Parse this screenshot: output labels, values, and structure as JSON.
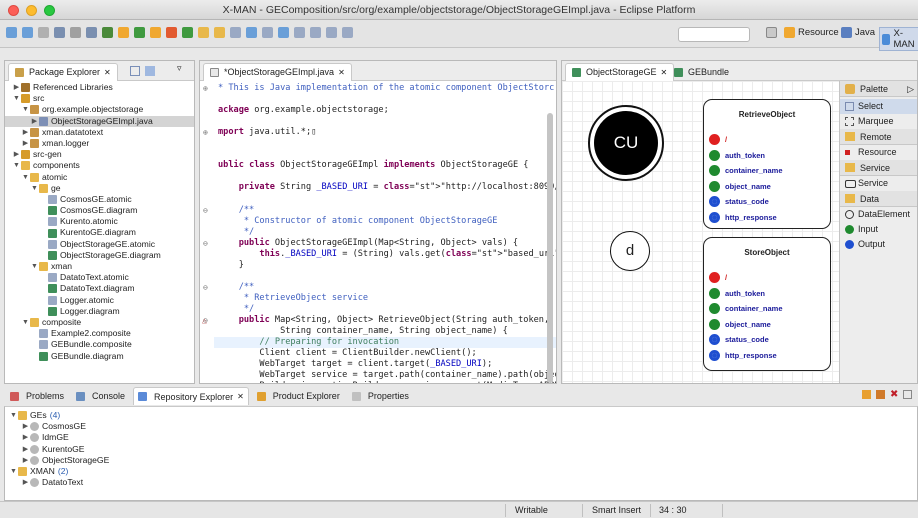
{
  "window": {
    "title": "X-MAN - GEComposition/src/org/example/objectstorage/ObjectStorageGEImpl.java - Eclipse Platform"
  },
  "toolbar": {
    "perspectives": [
      "Resource",
      "Java",
      "X-MAN"
    ]
  },
  "package_explorer": {
    "tab": "Package Explorer",
    "items": [
      {
        "label": "Referenced Libraries",
        "depth": 1,
        "twisty": "▶",
        "icon": "#a0702a"
      },
      {
        "label": "src",
        "depth": 1,
        "twisty": "▼",
        "icon": "#d69b2a"
      },
      {
        "label": "org.example.objectstorage",
        "depth": 2,
        "twisty": "▼",
        "icon": "#c79445"
      },
      {
        "label": "ObjectStorageGEImpl.java",
        "depth": 3,
        "twisty": "▶",
        "icon": "#7d8fb5",
        "selected": true
      },
      {
        "label": "xman.datatotext",
        "depth": 2,
        "twisty": "▶",
        "icon": "#c79445"
      },
      {
        "label": "xman.logger",
        "depth": 2,
        "twisty": "▶",
        "icon": "#c79445"
      },
      {
        "label": "src-gen",
        "depth": 1,
        "twisty": "▶",
        "icon": "#d69b2a"
      },
      {
        "label": "components",
        "depth": 1,
        "twisty": "▼",
        "icon": "#e8b84a"
      },
      {
        "label": "atomic",
        "depth": 2,
        "twisty": "▼",
        "icon": "#e8b84a"
      },
      {
        "label": "ge",
        "depth": 3,
        "twisty": "▼",
        "icon": "#e8b84a"
      },
      {
        "label": "CosmosGE.atomic",
        "depth": 4,
        "twisty": "",
        "icon": "#9aa9c4"
      },
      {
        "label": "CosmosGE.diagram",
        "depth": 4,
        "twisty": "",
        "icon": "#3f8f5a"
      },
      {
        "label": "Kurento.atomic",
        "depth": 4,
        "twisty": "",
        "icon": "#9aa9c4"
      },
      {
        "label": "KurentoGE.diagram",
        "depth": 4,
        "twisty": "",
        "icon": "#3f8f5a"
      },
      {
        "label": "ObjectStorageGE.atomic",
        "depth": 4,
        "twisty": "",
        "icon": "#9aa9c4"
      },
      {
        "label": "ObjectStorageGE.diagram",
        "depth": 4,
        "twisty": "",
        "icon": "#3f8f5a"
      },
      {
        "label": "xman",
        "depth": 3,
        "twisty": "▼",
        "icon": "#e8b84a"
      },
      {
        "label": "DatatoText.atomic",
        "depth": 4,
        "twisty": "",
        "icon": "#9aa9c4"
      },
      {
        "label": "DatatoText.diagram",
        "depth": 4,
        "twisty": "",
        "icon": "#3f8f5a"
      },
      {
        "label": "Logger.atomic",
        "depth": 4,
        "twisty": "",
        "icon": "#9aa9c4"
      },
      {
        "label": "Logger.diagram",
        "depth": 4,
        "twisty": "",
        "icon": "#3f8f5a"
      },
      {
        "label": "composite",
        "depth": 2,
        "twisty": "▼",
        "icon": "#e8b84a"
      },
      {
        "label": "Example2.composite",
        "depth": 3,
        "twisty": "",
        "icon": "#9aa9c4"
      },
      {
        "label": "GEBundle.composite",
        "depth": 3,
        "twisty": "",
        "icon": "#9aa9c4"
      },
      {
        "label": "GEBundle.diagram",
        "depth": 3,
        "twisty": "",
        "icon": "#3f8f5a"
      }
    ]
  },
  "editor": {
    "tab": "*ObjectStorageGEImpl.java",
    "lines": [
      {
        "t": "* This is Java implementation of the atomic component ObjectStorc",
        "c": "cm",
        "fold": "⊕"
      },
      {
        "t": "",
        "c": ""
      },
      {
        "t": "ackage org.example.objectstorage;",
        "c": ""
      },
      {
        "t": "",
        "c": ""
      },
      {
        "t": "mport java.util.*;▯",
        "c": "",
        "fold": "⊕"
      },
      {
        "t": "",
        "c": ""
      },
      {
        "t": "",
        "c": ""
      },
      {
        "t": "ublic class ObjectStorageGEImpl implements ObjectStorageGE {",
        "c": ""
      },
      {
        "t": "",
        "c": ""
      },
      {
        "t": "    private String _BASED_URI = \"http://localhost:8090/fiware/ge\";",
        "c": ""
      },
      {
        "t": "",
        "c": ""
      },
      {
        "t": "    /**",
        "c": "cm",
        "fold": "⊖"
      },
      {
        "t": "     * Constructor of atomic component ObjectStorageGE",
        "c": "cm"
      },
      {
        "t": "     */",
        "c": "cm"
      },
      {
        "t": "    public ObjectStorageGEImpl(Map<String, Object> vals) {",
        "c": "",
        "fold": "⊖"
      },
      {
        "t": "        this._BASED_URI = (String) vals.get(\"based_uri\");",
        "c": ""
      },
      {
        "t": "    }",
        "c": ""
      },
      {
        "t": "",
        "c": ""
      },
      {
        "t": "    /**",
        "c": "cm",
        "fold": "⊖"
      },
      {
        "t": "     * RetrieveObject service",
        "c": "cm"
      },
      {
        "t": "     */",
        "c": "cm"
      },
      {
        "t": "    public Map<String, Object> RetrieveObject(String auth_token,",
        "c": "",
        "fold": "⊖"
      },
      {
        "t": "            String container_name, String object_name) {",
        "c": ""
      },
      {
        "t": "        // Preparing for invocation",
        "c": "cmg",
        "hl": true
      },
      {
        "t": "        Client client = ClientBuilder.newClient();",
        "c": ""
      },
      {
        "t": "        WebTarget target = client.target(_BASED_URI);",
        "c": ""
      },
      {
        "t": "        WebTarget service = target.path(container_name).path(objec",
        "c": ""
      },
      {
        "t": "        Builder invocationBuilder = service.request(MediaType.APPL",
        "c": ""
      }
    ]
  },
  "diagram": {
    "tabs": [
      "ObjectStorageGE",
      "GEBundle"
    ],
    "connector_cu": "CU",
    "connector_d": "d",
    "components": [
      {
        "name": "RetrieveObject",
        "ports": [
          {
            "label": "/",
            "color": "#e02020"
          },
          {
            "label": "auth_token",
            "color": "#1f8a2f"
          },
          {
            "label": "container_name",
            "color": "#1f8a2f"
          },
          {
            "label": "object_name",
            "color": "#1f8a2f"
          },
          {
            "label": "status_code",
            "color": "#1f4fd0"
          },
          {
            "label": "http_response",
            "color": "#1f4fd0"
          }
        ]
      },
      {
        "name": "StoreObject",
        "ports": [
          {
            "label": "/",
            "color": "#e02020"
          },
          {
            "label": "auth_token",
            "color": "#1f8a2f"
          },
          {
            "label": "container_name",
            "color": "#1f8a2f"
          },
          {
            "label": "object_name",
            "color": "#1f8a2f"
          },
          {
            "label": "status_code",
            "color": "#1f4fd0"
          },
          {
            "label": "http_response",
            "color": "#1f4fd0"
          }
        ]
      }
    ]
  },
  "palette": {
    "title": "Palette",
    "select": "Select",
    "marquee": "Marquee",
    "remote": "Remote",
    "resource": "Resource",
    "service_group": "Service",
    "service": "Service",
    "data_group": "Data",
    "data_element": "DataElement",
    "input": "Input",
    "output": "Output"
  },
  "bottom": {
    "tabs": [
      "Problems",
      "Console",
      "Repository Explorer",
      "Product Explorer",
      "Properties"
    ],
    "active_tab": "Repository Explorer",
    "tree": [
      {
        "label": "GEs",
        "count": "(4)",
        "depth": 0,
        "twisty": "▼",
        "icon": "#e8b84a"
      },
      {
        "label": "CosmosGE",
        "depth": 1,
        "twisty": "▶",
        "icon": "#b8b8b8"
      },
      {
        "label": "IdmGE",
        "depth": 1,
        "twisty": "▶",
        "icon": "#b8b8b8"
      },
      {
        "label": "KurentoGE",
        "depth": 1,
        "twisty": "▶",
        "icon": "#b8b8b8"
      },
      {
        "label": "ObjectStorageGE",
        "depth": 1,
        "twisty": "▶",
        "icon": "#b8b8b8"
      },
      {
        "label": "XMAN",
        "count": "(2)",
        "depth": 0,
        "twisty": "▼",
        "icon": "#e8b84a"
      },
      {
        "label": "DatatoText",
        "depth": 1,
        "twisty": "▶",
        "icon": "#b8b8b8"
      }
    ]
  },
  "status": {
    "writable": "Writable",
    "insert_mode": "Smart Insert",
    "position": "34 : 30"
  }
}
